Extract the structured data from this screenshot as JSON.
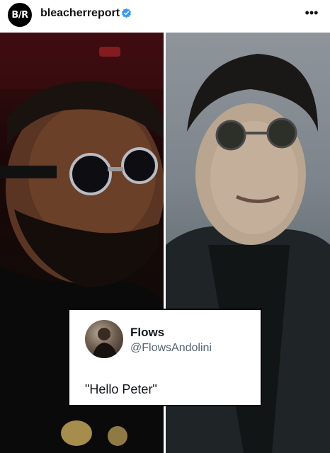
{
  "header": {
    "logo_text": "B/R",
    "username": "bleacherreport",
    "verified_color": "#3897f0",
    "more_icon": "more-horizontal-icon"
  },
  "tweet": {
    "name": "Flows",
    "handle": "@FlowsAndolini",
    "text": "\"Hello Peter\""
  }
}
